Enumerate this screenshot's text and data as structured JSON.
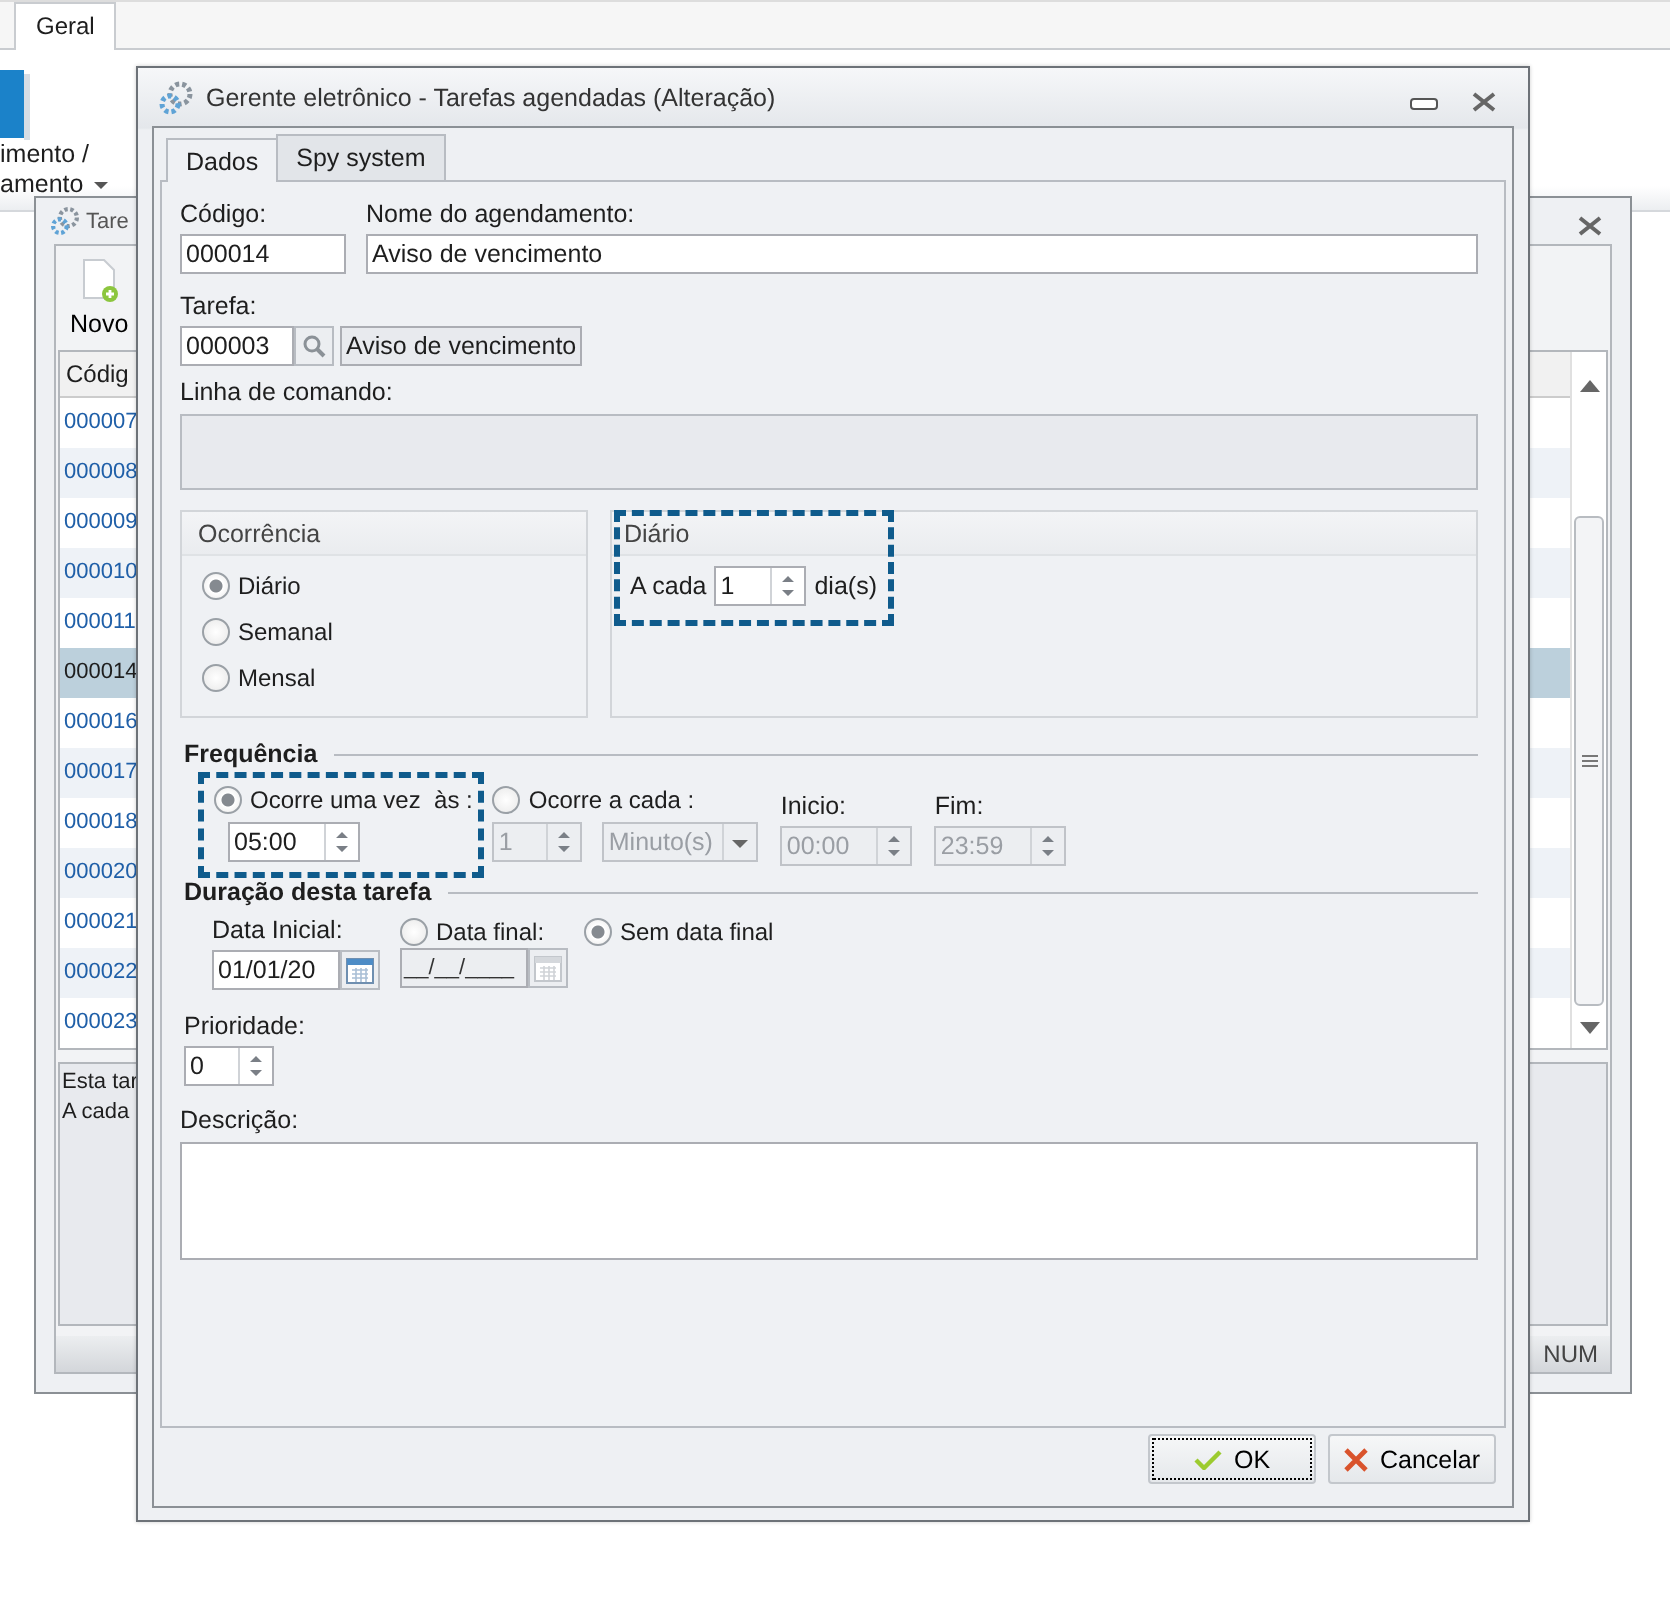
{
  "ribbon": {
    "tab": {
      "label": "Geral",
      "selected": true
    },
    "button_lines": [
      "imento /",
      "amento"
    ]
  },
  "back_window": {
    "title": "Tare",
    "toolbar_button": "Novo",
    "grid": {
      "header": "Códig",
      "rows": [
        {
          "code": "000007",
          "selected": false
        },
        {
          "code": "000008",
          "selected": false
        },
        {
          "code": "000009",
          "selected": false
        },
        {
          "code": "000010",
          "selected": false
        },
        {
          "code": "000011",
          "selected": false
        },
        {
          "code": "000014",
          "selected": true
        },
        {
          "code": "000016",
          "selected": false
        },
        {
          "code": "000017",
          "selected": false
        },
        {
          "code": "000018",
          "selected": false
        },
        {
          "code": "000020",
          "selected": false
        },
        {
          "code": "000021",
          "selected": false
        },
        {
          "code": "000022",
          "selected": false
        },
        {
          "code": "000023",
          "selected": false
        }
      ]
    },
    "info_lines": [
      "Esta tar",
      "A cada"
    ],
    "status_bar": "NUM"
  },
  "dialog": {
    "title": "Gerente eletrônico - Tarefas agendadas (Alteração)",
    "tabs": [
      {
        "label": "Dados",
        "selected": true
      },
      {
        "label": "Spy system",
        "selected": false
      }
    ],
    "codigo": {
      "label": "Código:",
      "value": "000014"
    },
    "nome": {
      "label": "Nome do agendamento:",
      "value": "Aviso de vencimento"
    },
    "tarefa": {
      "label": "Tarefa:",
      "value": "000003",
      "description": "Aviso de vencimento"
    },
    "linha_de_comando": {
      "label": "Linha de comando:"
    },
    "ocorrencia": {
      "title": "Ocorrência",
      "options": [
        {
          "label": "Diário",
          "selected": true
        },
        {
          "label": "Semanal",
          "selected": false
        },
        {
          "label": "Mensal",
          "selected": false
        }
      ]
    },
    "diario": {
      "title": "Diário",
      "prefix": "A cada",
      "value": "1",
      "suffix": "dia(s)",
      "highlighted": true
    },
    "frequencia": {
      "title": "Frequência",
      "once": {
        "label": "Ocorre uma vez  às :",
        "selected": true,
        "time": "05:00",
        "highlighted": true
      },
      "every": {
        "label": "Ocorre a cada :",
        "selected": false,
        "value": "1",
        "unit": "Minuto(s)",
        "start_label": "Inicio:",
        "start": "00:00",
        "end_label": "Fim:",
        "end": "23:59",
        "disabled": true
      }
    },
    "duracao": {
      "title": "Duração desta tarefa",
      "start_label": "Data Inicial:",
      "start_date": "01/01/20",
      "end_options": [
        {
          "kind": "date",
          "label": "Data final:",
          "selected": false,
          "value": "__/__/____"
        },
        {
          "kind": "none",
          "label": "Sem data final",
          "selected": true
        }
      ]
    },
    "prioridade": {
      "label": "Prioridade:",
      "value": "0"
    },
    "descricao": {
      "label": "Descrição:"
    },
    "buttons": [
      {
        "kind": "ok",
        "label": "OK",
        "focused": true
      },
      {
        "kind": "cancel",
        "label": "Cancelar",
        "focused": false
      }
    ]
  }
}
